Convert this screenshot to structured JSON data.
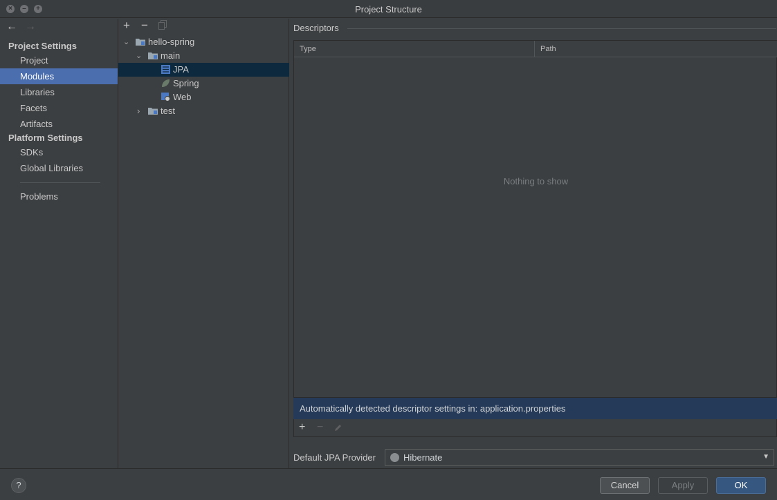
{
  "window": {
    "title": "Project Structure"
  },
  "sidebar": {
    "project_settings_header": "Project Settings",
    "project_items": [
      "Project",
      "Modules",
      "Libraries",
      "Facets",
      "Artifacts"
    ],
    "platform_settings_header": "Platform Settings",
    "platform_items": [
      "SDKs",
      "Global Libraries"
    ],
    "problems": "Problems",
    "selected": "Modules"
  },
  "tree": {
    "root": "hello-spring",
    "main": "main",
    "children": [
      "JPA",
      "Spring",
      "Web"
    ],
    "test": "test",
    "selected": "JPA"
  },
  "descriptors": {
    "title": "Descriptors",
    "columns": {
      "type": "Type",
      "path": "Path"
    },
    "empty_text": "Nothing to show",
    "detected_text": "Automatically detected descriptor settings in: application.properties"
  },
  "jpa_provider": {
    "label": "Default JPA Provider",
    "value": "Hibernate"
  },
  "buttons": {
    "help": "?",
    "cancel": "Cancel",
    "apply": "Apply",
    "ok": "OK"
  },
  "colors": {
    "selection_blue": "#4b6eaf",
    "tree_selection": "#0d293e",
    "detected_row": "#243a58",
    "ok_button": "#365880"
  }
}
